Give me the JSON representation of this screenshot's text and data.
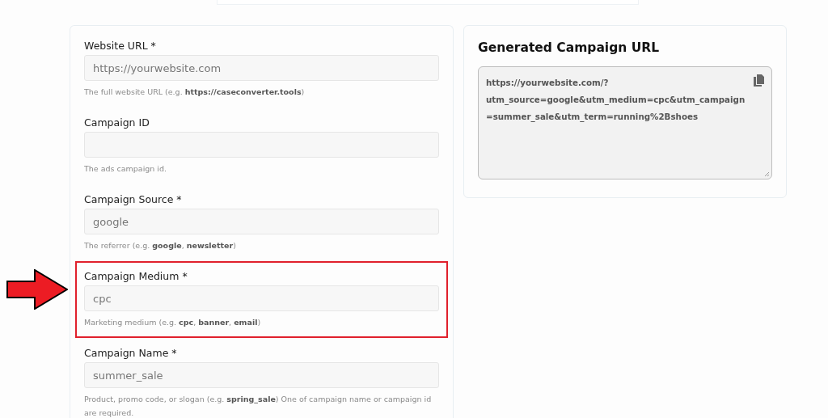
{
  "form": {
    "fields": [
      {
        "label": "Website URL *",
        "placeholder": "https://yourwebsite.com",
        "hint": "The full website URL (e.g. **https://caseconverter.tools**)",
        "highlighted": false
      },
      {
        "label": "Campaign ID",
        "hint": "The ads campaign id.",
        "highlighted": false
      },
      {
        "label": "Campaign Source *",
        "placeholder": "google",
        "hint": "The referrer (e.g. **google**, **newsletter**)",
        "highlighted": false
      },
      {
        "label": "Campaign Medium *",
        "placeholder": "cpc",
        "hint": "Marketing medium (e.g. **cpc**, **banner**, **email**)",
        "highlighted": true
      },
      {
        "label": "Campaign Name *",
        "placeholder": "summer_sale",
        "hint": "Product, promo code, or slogan (e.g. **spring_sale**) One of campaign name or campaign id are required.",
        "highlighted": false
      }
    ]
  },
  "output": {
    "title": "Generated Campaign URL",
    "url": "https://yourwebsite.com/?utm_source=google&utm_medium=cpc&utm_campaign=summer_sale&utm_term=running%2Bshoes"
  }
}
